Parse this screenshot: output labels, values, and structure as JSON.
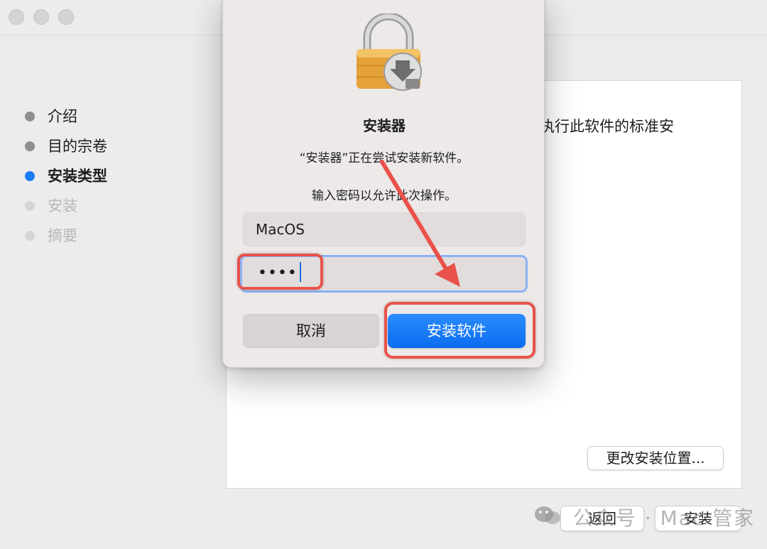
{
  "installer": {
    "steps": [
      {
        "label": "介绍",
        "state": "done"
      },
      {
        "label": "目的宗卷",
        "state": "done"
      },
      {
        "label": "安装类型",
        "state": "active"
      },
      {
        "label": "安装",
        "state": "future"
      },
      {
        "label": "摘要",
        "state": "future"
      }
    ],
    "content_text": "执行此软件的标准安",
    "change_location_label": "更改安装位置...",
    "back_label": "返回",
    "install_label": "安装"
  },
  "dialog": {
    "title": "安装器",
    "message": "“安装器”正在尝试安装新软件。",
    "prompt": "输入密码以允许此次操作。",
    "username": "MacOS",
    "password_mask": "••••",
    "cancel_label": "取消",
    "install_software_label": "安装软件"
  },
  "watermark": "公众号 · Mac 管家",
  "colors": {
    "accent": "#1a7cf5",
    "highlight": "#e8524a",
    "button_primary": "#0b6cf0"
  }
}
